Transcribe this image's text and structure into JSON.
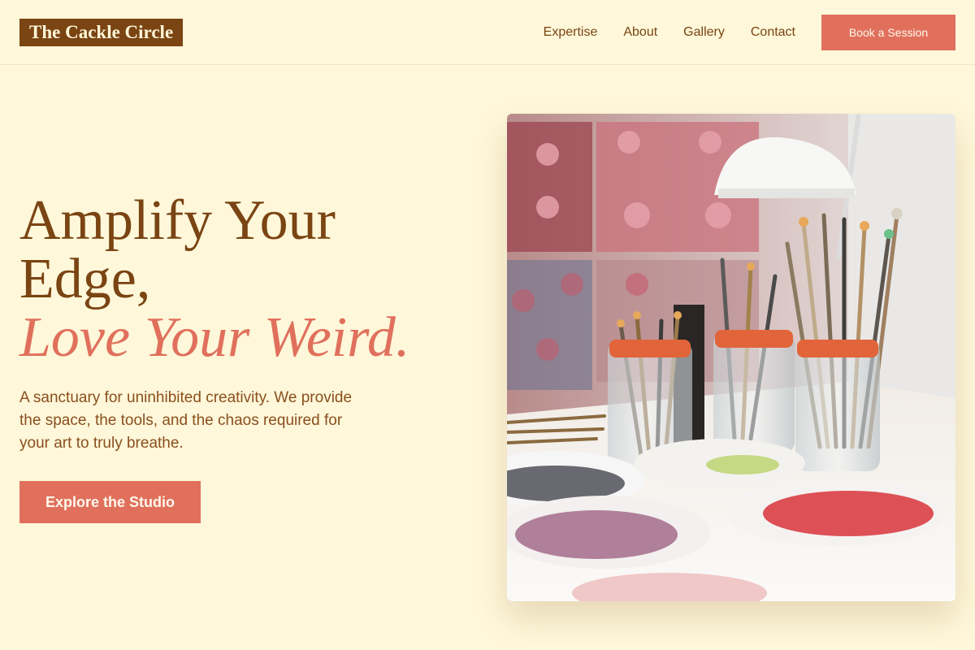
{
  "brand": {
    "name": "The Cackle Circle"
  },
  "nav": {
    "items": [
      "Expertise",
      "About",
      "Gallery",
      "Contact"
    ],
    "cta_label": "Book a Session"
  },
  "hero": {
    "title_line1": "Amplify Your",
    "title_line2": "Edge,",
    "title_emphasis": "Love Your Weird.",
    "subtitle": "A sanctuary for uninhibited creativity. We provide the space, the tools, and the chaos required for your art to truly breathe.",
    "cta_label": "Explore the Studio"
  },
  "colors": {
    "background": "#fef7d9",
    "brown": "#7a4413",
    "coral": "#e0705c"
  }
}
